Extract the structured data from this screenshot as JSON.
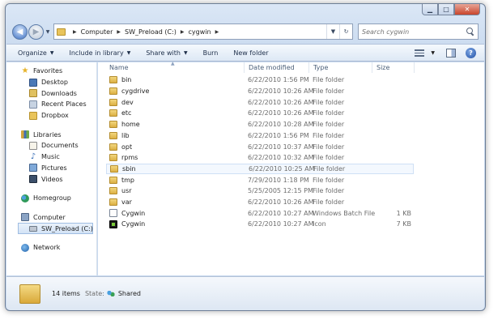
{
  "window": {
    "caption": {
      "minimize": "▁",
      "maximize": "□",
      "close": "✕"
    }
  },
  "address": {
    "back": "◀",
    "forward": "▶",
    "history": "▼",
    "crumbs": [
      "Computer",
      "SW_Preload (C:)",
      "cygwin"
    ],
    "refresh": "↻",
    "dropdown": "▼"
  },
  "search": {
    "placeholder": "Search cygwin"
  },
  "toolbar": {
    "organize": "Organize",
    "include_in_library": "Include in library",
    "share_with": "Share with",
    "burn": "Burn",
    "new_folder": "New folder",
    "help": "?",
    "arrow": "▼"
  },
  "nav": {
    "favorites": {
      "label": "Favorites",
      "items": [
        "Desktop",
        "Downloads",
        "Recent Places",
        "Dropbox"
      ]
    },
    "libraries": {
      "label": "Libraries",
      "items": [
        "Documents",
        "Music",
        "Pictures",
        "Videos"
      ]
    },
    "homegroup": "Homegroup",
    "computer": {
      "label": "Computer",
      "items": [
        "SW_Preload (C:)"
      ]
    },
    "network": "Network"
  },
  "columns": {
    "name": "Name",
    "date": "Date modified",
    "type": "Type",
    "size": "Size"
  },
  "files": [
    {
      "name": "bin",
      "date": "6/22/2010 1:56 PM",
      "type": "File folder",
      "size": "",
      "icon": "folder"
    },
    {
      "name": "cygdrive",
      "date": "6/22/2010 10:26 AM",
      "type": "File folder",
      "size": "",
      "icon": "folder"
    },
    {
      "name": "dev",
      "date": "6/22/2010 10:26 AM",
      "type": "File folder",
      "size": "",
      "icon": "folder"
    },
    {
      "name": "etc",
      "date": "6/22/2010 10:26 AM",
      "type": "File folder",
      "size": "",
      "icon": "folder"
    },
    {
      "name": "home",
      "date": "6/22/2010 10:28 AM",
      "type": "File folder",
      "size": "",
      "icon": "folder"
    },
    {
      "name": "lib",
      "date": "6/22/2010 1:56 PM",
      "type": "File folder",
      "size": "",
      "icon": "folder"
    },
    {
      "name": "opt",
      "date": "6/22/2010 10:37 AM",
      "type": "File folder",
      "size": "",
      "icon": "folder"
    },
    {
      "name": "rpms",
      "date": "6/22/2010 10:32 AM",
      "type": "File folder",
      "size": "",
      "icon": "folder"
    },
    {
      "name": "sbin",
      "date": "6/22/2010 10:25 AM",
      "type": "File folder",
      "size": "",
      "icon": "folder"
    },
    {
      "name": "tmp",
      "date": "7/29/2010 1:18 PM",
      "type": "File folder",
      "size": "",
      "icon": "folder"
    },
    {
      "name": "usr",
      "date": "5/25/2005 12:15 PM",
      "type": "File folder",
      "size": "",
      "icon": "folder"
    },
    {
      "name": "var",
      "date": "6/22/2010 10:26 AM",
      "type": "File folder",
      "size": "",
      "icon": "folder"
    },
    {
      "name": "Cygwin",
      "date": "6/22/2010 10:27 AM",
      "type": "Windows Batch File",
      "size": "1 KB",
      "icon": "batch"
    },
    {
      "name": "Cygwin",
      "date": "6/22/2010 10:27 AM",
      "type": "Icon",
      "size": "7 KB",
      "icon": "icon"
    }
  ],
  "details": {
    "count": "14 items",
    "state_label": "State:",
    "state": "Shared"
  }
}
